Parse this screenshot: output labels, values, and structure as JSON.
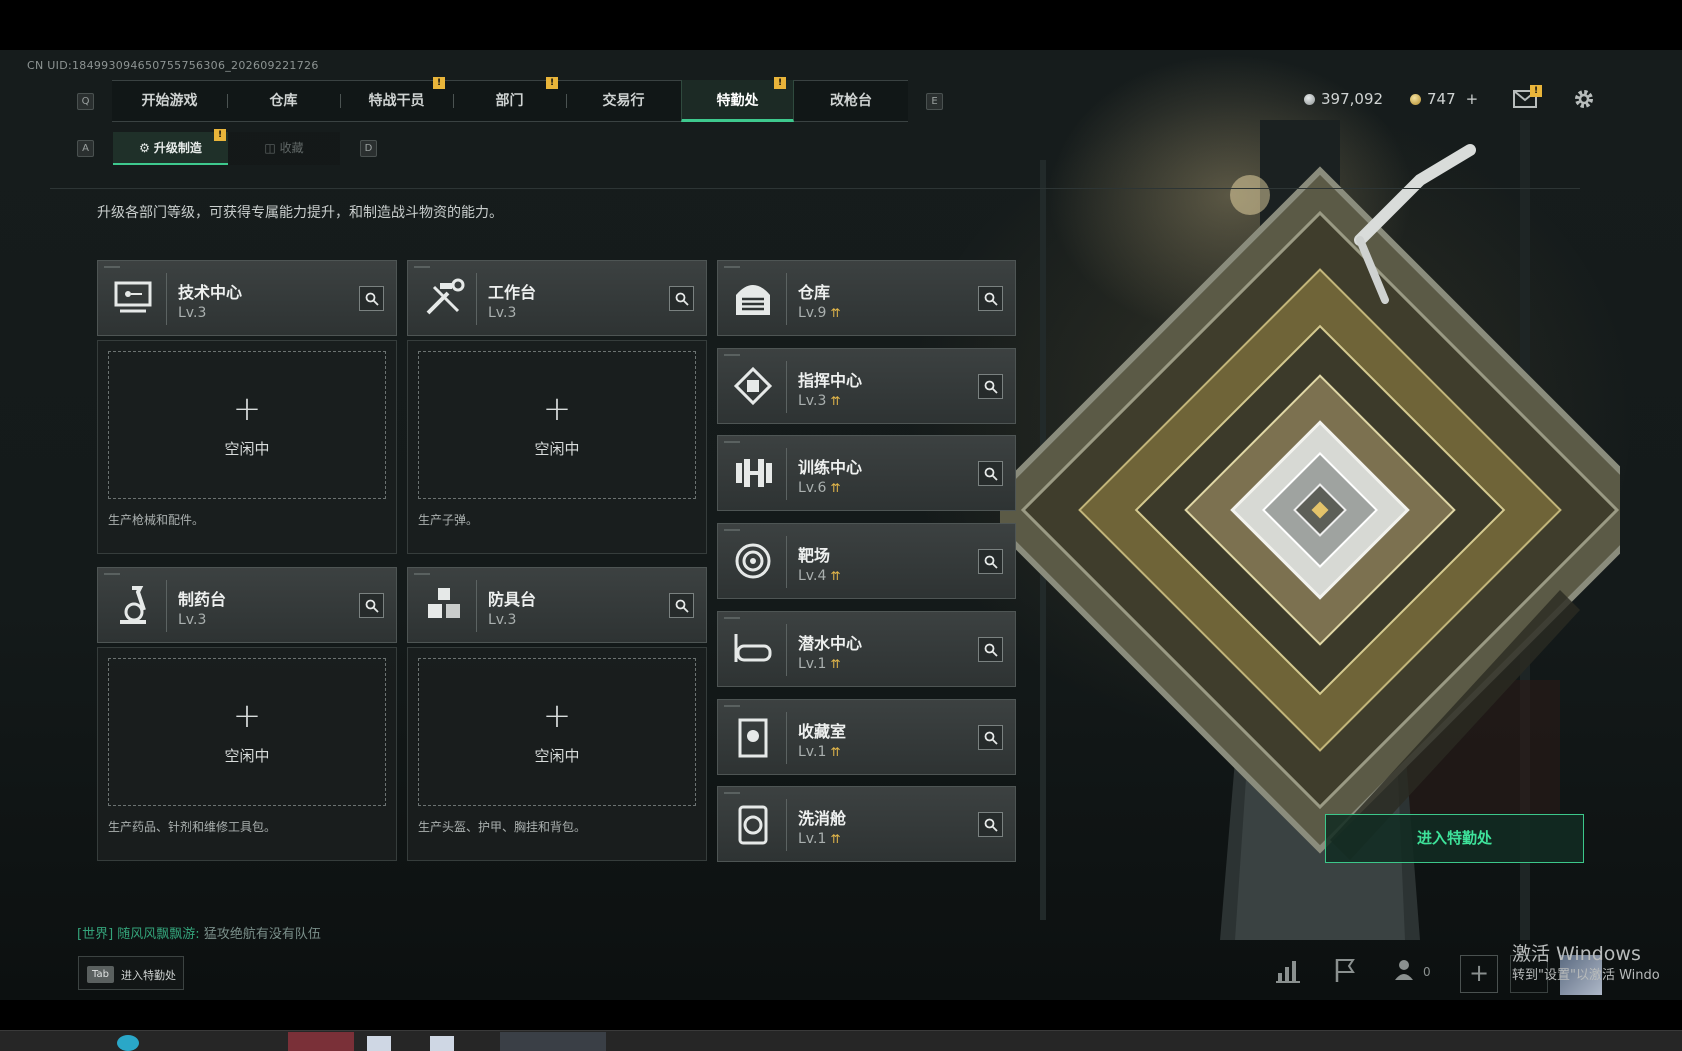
{
  "uid": "CN UID:184993094650755756306_202609221726",
  "nav": {
    "key_left": "Q",
    "key_right": "E",
    "tabs": [
      {
        "label": "开始游戏",
        "alert": false,
        "active": false
      },
      {
        "label": "仓库",
        "alert": false,
        "active": false
      },
      {
        "label": "特战干员",
        "alert": true,
        "active": false
      },
      {
        "label": "部门",
        "alert": true,
        "active": false
      },
      {
        "label": "交易行",
        "alert": false,
        "active": false
      },
      {
        "label": "特勤处",
        "alert": true,
        "active": true
      },
      {
        "label": "改枪台",
        "alert": false,
        "active": false
      }
    ],
    "alert_mark": "!"
  },
  "currency": {
    "silver": "397,092",
    "gold": "747",
    "add": "+"
  },
  "subtabs": {
    "key_left": "A",
    "key_right": "D",
    "items": [
      {
        "label": "升级制造",
        "active": true,
        "alert": true
      },
      {
        "label": "收藏",
        "active": false,
        "alert": false
      }
    ]
  },
  "description": "升级各部门等级，可获得专属能力提升，和制造战斗物资的能力。",
  "workshops": [
    {
      "name": "技术中心",
      "level": "Lv.3",
      "icon": "tech-center-icon",
      "idle": "空闲中",
      "note": "生产枪械和配件。"
    },
    {
      "name": "工作台",
      "level": "Lv.3",
      "icon": "workbench-icon",
      "idle": "空闲中",
      "note": "生产子弹。"
    },
    {
      "name": "制药台",
      "level": "Lv.3",
      "icon": "pharmacy-icon",
      "idle": "空闲中",
      "note": "生产药品、针剂和维修工具包。"
    },
    {
      "name": "防具台",
      "level": "Lv.3",
      "icon": "armor-bench-icon",
      "idle": "空闲中",
      "note": "生产头盔、护甲、胸挂和背包。"
    }
  ],
  "facilities": [
    {
      "name": "仓库",
      "level": "Lv.9",
      "icon": "warehouse-icon"
    },
    {
      "name": "指挥中心",
      "level": "Lv.3",
      "icon": "command-center-icon"
    },
    {
      "name": "训练中心",
      "level": "Lv.6",
      "icon": "training-center-icon"
    },
    {
      "name": "靶场",
      "level": "Lv.4",
      "icon": "shooting-range-icon"
    },
    {
      "name": "潜水中心",
      "level": "Lv.1",
      "icon": "diving-center-icon"
    },
    {
      "name": "收藏室",
      "level": "Lv.1",
      "icon": "collection-room-icon"
    },
    {
      "name": "洗消舱",
      "level": "Lv.1",
      "icon": "decontamination-icon"
    }
  ],
  "enter_button": "进入特勤处",
  "chat": {
    "channel": "[世界]",
    "sender": "随风风飘飘游:",
    "message": "猛攻绝航有没有队伍"
  },
  "tab_hint": {
    "key": "Tab",
    "label": "进入特勤处"
  },
  "bottom": {
    "friends_count": "0",
    "plus": "+"
  },
  "watermark": {
    "line1": "激活 Windows",
    "line2": "转到\"设置\"以激活 Windo"
  },
  "colors": {
    "accent": "#3ec98e",
    "alert": "#e9b53a",
    "upgrade": "#e2b64a"
  }
}
